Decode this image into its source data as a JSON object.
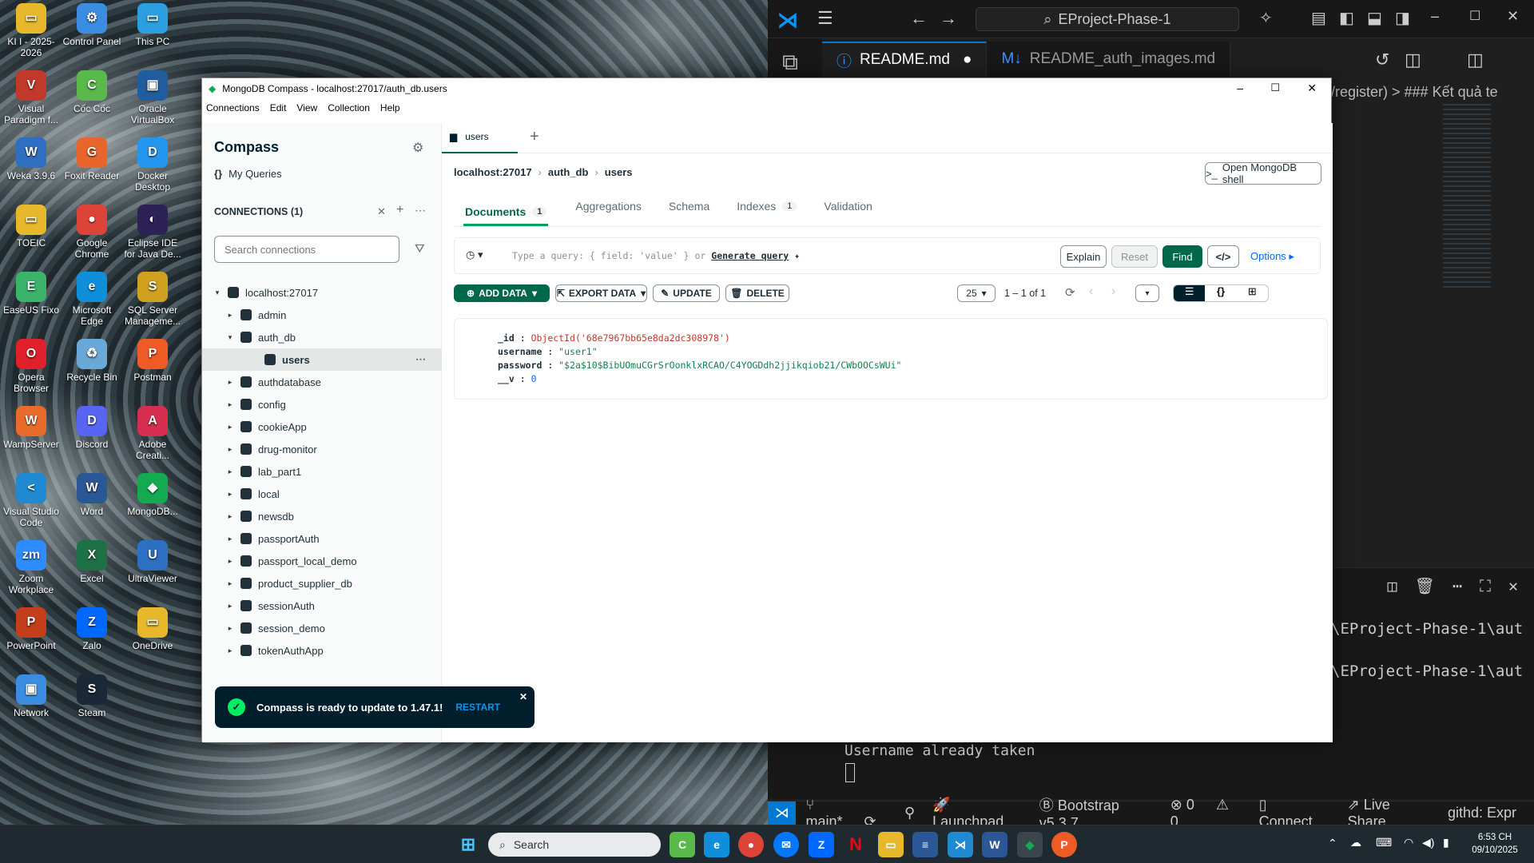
{
  "desktop": {
    "icons": [
      {
        "label": "KI I - 2025-2026",
        "color": "#e8b82c",
        "glyph": "▭"
      },
      {
        "label": "Control Panel",
        "color": "#3a8de0",
        "glyph": "⚙"
      },
      {
        "label": "This PC",
        "color": "#2b9fe0",
        "glyph": "▭"
      },
      {
        "label": "Visual Paradigm f...",
        "color": "#c0392b",
        "glyph": "V"
      },
      {
        "label": "Cốc Cốc",
        "color": "#59b94b",
        "glyph": "C"
      },
      {
        "label": "Oracle VirtualBox",
        "color": "#1f5d9e",
        "glyph": "▣"
      },
      {
        "label": "Weka 3.9.6",
        "color": "#2f6fc1",
        "glyph": "W"
      },
      {
        "label": "Foxit Reader",
        "color": "#e8662c",
        "glyph": "G"
      },
      {
        "label": "Docker Desktop",
        "color": "#2496ed",
        "glyph": "D"
      },
      {
        "label": "TOEIC",
        "color": "#e8b82c",
        "glyph": "▭"
      },
      {
        "label": "Google Chrome",
        "color": "#db4437",
        "glyph": "●"
      },
      {
        "label": "Eclipse IDE for Java De...",
        "color": "#2c2255",
        "glyph": "◐"
      },
      {
        "label": "EaseUS Fixo",
        "color": "#3bb36b",
        "glyph": "E"
      },
      {
        "label": "Microsoft Edge",
        "color": "#0f8ed9",
        "glyph": "e"
      },
      {
        "label": "SQL Server Manageme...",
        "color": "#d0a020",
        "glyph": "S"
      },
      {
        "label": "Opera Browser",
        "color": "#e0202a",
        "glyph": "O"
      },
      {
        "label": "Recycle Bin",
        "color": "#6aa8d8",
        "glyph": "♻"
      },
      {
        "label": "Postman",
        "color": "#ef5b25",
        "glyph": "P"
      },
      {
        "label": "WampServer",
        "color": "#e96b2c",
        "glyph": "W"
      },
      {
        "label": "Discord",
        "color": "#5865f2",
        "glyph": "D"
      },
      {
        "label": "Adobe Creati...",
        "color": "#d62e4f",
        "glyph": "A"
      },
      {
        "label": "Visual Studio Code",
        "color": "#1f8ad2",
        "glyph": "<"
      },
      {
        "label": "Word",
        "color": "#2b5797",
        "glyph": "W"
      },
      {
        "label": "MongoDB...",
        "color": "#13aa52",
        "glyph": "◆"
      },
      {
        "label": "Zoom Workplace",
        "color": "#2d8cff",
        "glyph": "zm"
      },
      {
        "label": "Excel",
        "color": "#1e7145",
        "glyph": "X"
      },
      {
        "label": "UltraViewer",
        "color": "#2d6fc0",
        "glyph": "U"
      },
      {
        "label": "PowerPoint",
        "color": "#c43e1c",
        "glyph": "P"
      },
      {
        "label": "Zalo",
        "color": "#0068ff",
        "glyph": "Z"
      },
      {
        "label": "OneDrive",
        "color": "#e8b82c",
        "glyph": "▭"
      },
      {
        "label": "Network",
        "color": "#3a8de0",
        "glyph": "▣"
      },
      {
        "label": "Steam",
        "color": "#1b2838",
        "glyph": "S"
      }
    ]
  },
  "vscode": {
    "command_center": "EProject-Phase-1",
    "tabs": [
      {
        "label": "README.md"
      },
      {
        "label": "README_auth_images.md"
      }
    ],
    "breadcrumb": "/register) > ### Kết quả te",
    "terminal": {
      "lines": [
        "\\EProject-Phase-1\\aut",
        "\\EProject-Phase-1\\aut",
        "Username already taken"
      ]
    },
    "status": {
      "branch": "main*",
      "problems_errors": "0",
      "problems_warnings": "0",
      "launchpad": "Launchpad",
      "bootstrap": "Bootstrap v5.3.7",
      "connect": "Connect",
      "live_share": "Live Share",
      "githd": "githd: Expr"
    }
  },
  "compass": {
    "title": "MongoDB Compass - localhost:27017/auth_db.users",
    "menu": [
      "Connections",
      "Edit",
      "View",
      "Collection",
      "Help"
    ],
    "sidebar": {
      "app_name": "Compass",
      "my_queries": "My Queries",
      "connections_label": "CONNECTIONS (1)",
      "search_placeholder": "Search connections",
      "connection": "localhost:27017",
      "databases": [
        "admin",
        "auth_db",
        "authdatabase",
        "config",
        "cookieApp",
        "drug-monitor",
        "lab_part1",
        "local",
        "newsdb",
        "passportAuth",
        "passport_local_demo",
        "product_supplier_db",
        "sessionAuth",
        "session_demo",
        "tokenAuthApp"
      ],
      "expanded_db": "auth_db",
      "collection": "users"
    },
    "workspace_tab": "users",
    "breadcrumb": {
      "host": "localhost:27017",
      "db": "auth_db",
      "collection": "users"
    },
    "open_shell": "Open MongoDB shell",
    "tabs": [
      {
        "label": "Documents",
        "count": "1"
      },
      {
        "label": "Aggregations",
        "count": ""
      },
      {
        "label": "Schema",
        "count": ""
      },
      {
        "label": "Indexes",
        "count": "1"
      },
      {
        "label": "Validation",
        "count": ""
      }
    ],
    "query": {
      "placeholder": "Type a query: { field: 'value' } or",
      "generate": "Generate query",
      "explain": "Explain",
      "reset": "Reset",
      "find": "Find",
      "options": "Options"
    },
    "actions": {
      "add": "ADD DATA",
      "export": "EXPORT DATA",
      "update": "UPDATE",
      "delete": "DELETE"
    },
    "pagination": {
      "page_size": "25",
      "range": "1 – 1 of 1"
    },
    "document": {
      "id_key": "_id",
      "id_val": "ObjectId('68e7967bb65e8da2dc308978')",
      "username_key": "username",
      "username_val": "\"user1\"",
      "password_key": "password",
      "password_val": "\"$2a$10$BibUOmuCGrSrOonklxRCAO/C4YOGDdh2jjikqiob21/CWbOOCsWUi\"",
      "v_key": "__v",
      "v_val": "0"
    },
    "toast": {
      "message": "Compass is ready to update to 1.47.1!",
      "action": "RESTART"
    }
  },
  "taskbar": {
    "search_placeholder": "Search",
    "time": "6:53 CH",
    "date": "09/10/2025"
  }
}
